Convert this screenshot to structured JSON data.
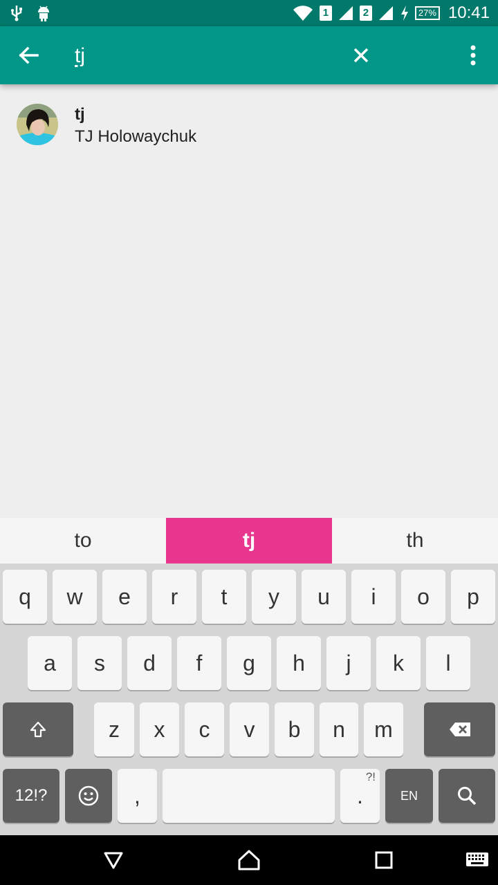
{
  "status_bar": {
    "sim1": "1",
    "sim2": "2",
    "battery": "27%",
    "time": "10:41",
    "icons": [
      "usb-icon",
      "android-icon",
      "wifi-icon",
      "signal-icon",
      "signal-icon",
      "charging-icon"
    ]
  },
  "app_bar": {
    "query": "tj",
    "back_icon": "arrow-back-icon",
    "clear_icon": "close-icon",
    "more_icon": "more-vert-icon",
    "color": "#009688"
  },
  "results": [
    {
      "login": "tj",
      "name": "TJ Holowaychuk"
    }
  ],
  "keyboard": {
    "suggestions": [
      "to",
      "tj",
      "th"
    ],
    "active_suggestion": 1,
    "row1": [
      "q",
      "w",
      "e",
      "r",
      "t",
      "y",
      "u",
      "i",
      "o",
      "p"
    ],
    "row2": [
      "a",
      "s",
      "d",
      "f",
      "g",
      "h",
      "j",
      "k",
      "l"
    ],
    "row3": [
      "z",
      "x",
      "c",
      "v",
      "b",
      "n",
      "m"
    ],
    "symbols_label": "12!?",
    "comma_label": ",",
    "period_label": ".",
    "period_hint": "?!",
    "language_label": "EN",
    "accent_color": "#e8368f"
  },
  "nav_bar": {
    "icons": [
      "back-triangle-icon",
      "home-icon",
      "recents-icon",
      "keyboard-icon"
    ]
  }
}
